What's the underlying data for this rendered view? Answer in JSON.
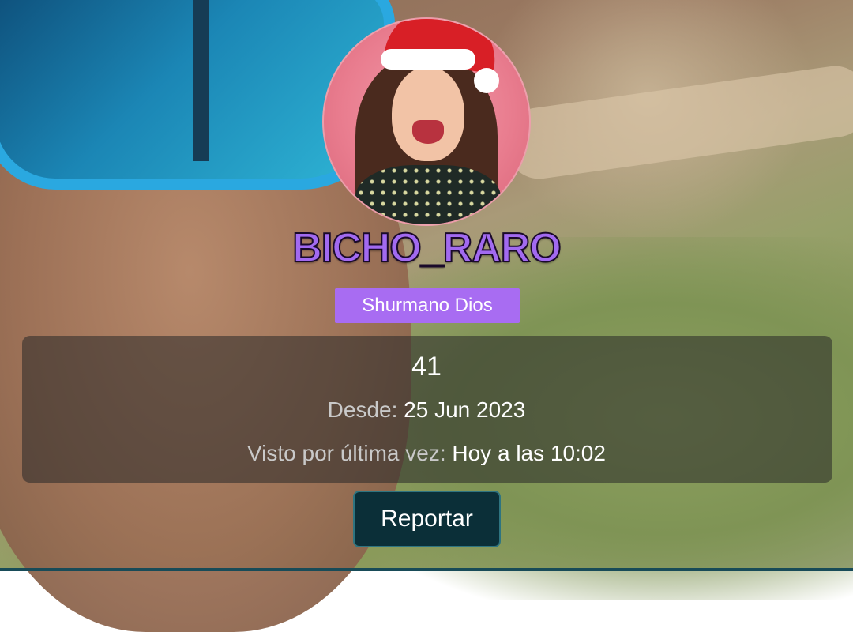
{
  "profile": {
    "username": "BICHO_RARO",
    "role": "Shurmano Dios",
    "count": "41",
    "since_label": "Desde:",
    "since_value": "25 Jun 2023",
    "last_seen_label": "Visto por última vez:",
    "last_seen_value": "Hoy a las 10:02",
    "report_label": "Reportar"
  },
  "colors": {
    "username": "#a26af0",
    "role_badge": "#a86cf2",
    "report_button": "#0b2f38"
  }
}
